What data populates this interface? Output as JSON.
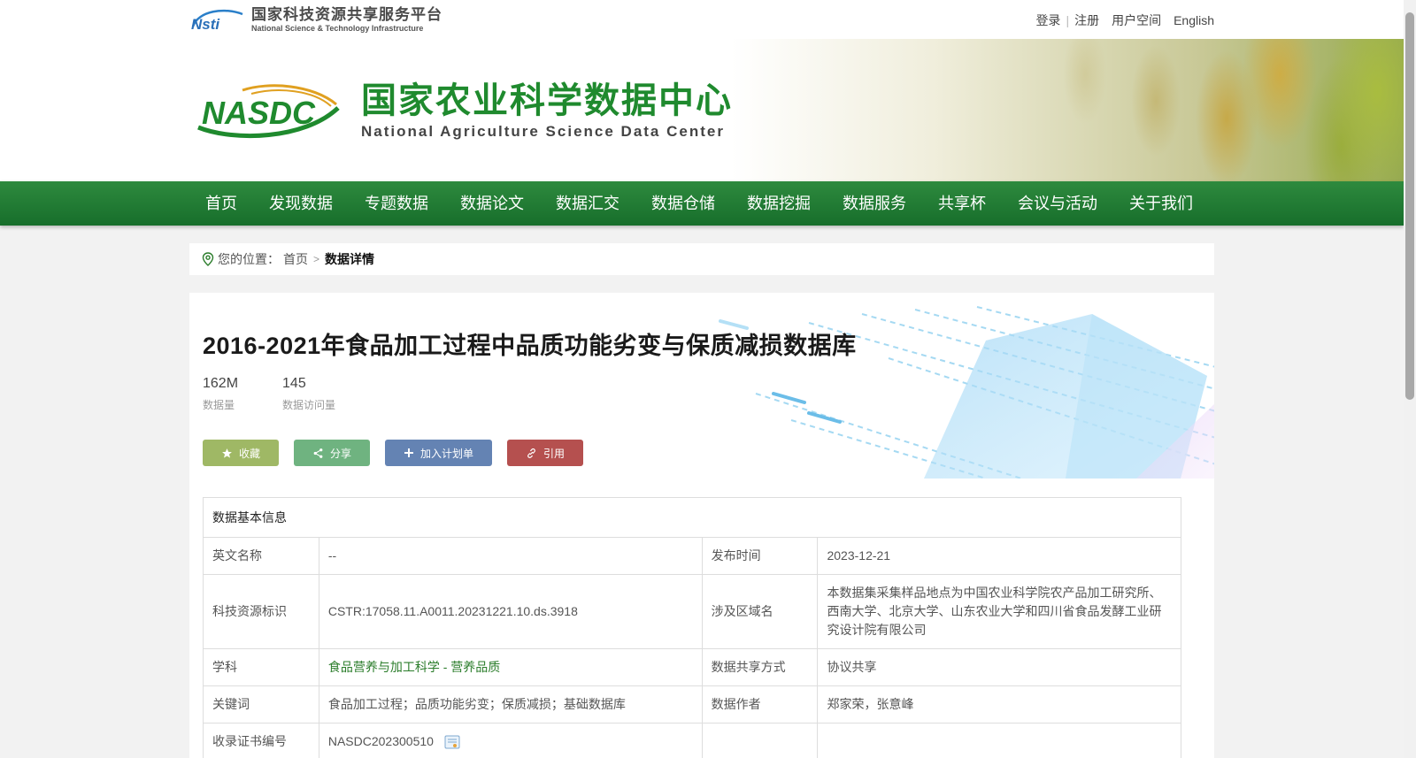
{
  "platform": {
    "abbr": "Nsti",
    "name_cn": "国家科技资源共享服务平台",
    "name_en": "National Science & Technology Infrastructure"
  },
  "top_links": {
    "login": "登录",
    "register": "注册",
    "user_space": "用户空间",
    "english": "English"
  },
  "brand": {
    "logo_text": "NASDC",
    "name_cn": "国家农业科学数据中心",
    "name_en": "National Agriculture Science Data Center"
  },
  "nav": {
    "items": [
      "首页",
      "发现数据",
      "专题数据",
      "数据论文",
      "数据汇交",
      "数据仓储",
      "数据挖掘",
      "数据服务",
      "共享杯",
      "会议与活动",
      "关于我们"
    ]
  },
  "breadcrumb": {
    "prefix": "您的位置：",
    "home": "首页",
    "separator": ">",
    "current": "数据详情"
  },
  "dataset": {
    "title": "2016-2021年食品加工过程中品质功能劣变与保质减损数据库",
    "size_value": "162M",
    "size_label": "数据量",
    "visits_value": "145",
    "visits_label": "数据访问量"
  },
  "actions": {
    "favorite": "收藏",
    "share": "分享",
    "add_plan": "加入计划单",
    "cite": "引用"
  },
  "info": {
    "header": "数据基本信息",
    "rows": [
      {
        "label": "英文名称",
        "value": "--",
        "label2": "发布时间",
        "value2": "2023-12-21"
      },
      {
        "label": "科技资源标识",
        "value": "CSTR:17058.11.A0011.20231221.10.ds.3918",
        "label2": "涉及区域名",
        "value2": "本数据集采集样品地点为中国农业科学院农产品加工研究所、西南大学、北京大学、山东农业大学和四川省食品发酵工业研究设计院有限公司"
      },
      {
        "label": "学科",
        "value": "食品营养与加工科学 - 营养品质",
        "label2": "数据共享方式",
        "value2": "协议共享"
      },
      {
        "label": "关键词",
        "value": "食品加工过程；品质功能劣变；保质减损；基础数据库",
        "label2": "数据作者",
        "value2": "郑家荣，张意峰"
      },
      {
        "label": "收录证书编号",
        "value": "NASDC202300510",
        "label2": "",
        "value2": ""
      }
    ]
  },
  "colors": {
    "nav_green": "#1f7a31",
    "brand_green": "#1f8a2e",
    "btn_favorite": "#9fb865",
    "btn_share": "#6fb380",
    "btn_plan": "#6483b3",
    "btn_cite": "#b5504f",
    "link_green": "#2b7d2b"
  }
}
